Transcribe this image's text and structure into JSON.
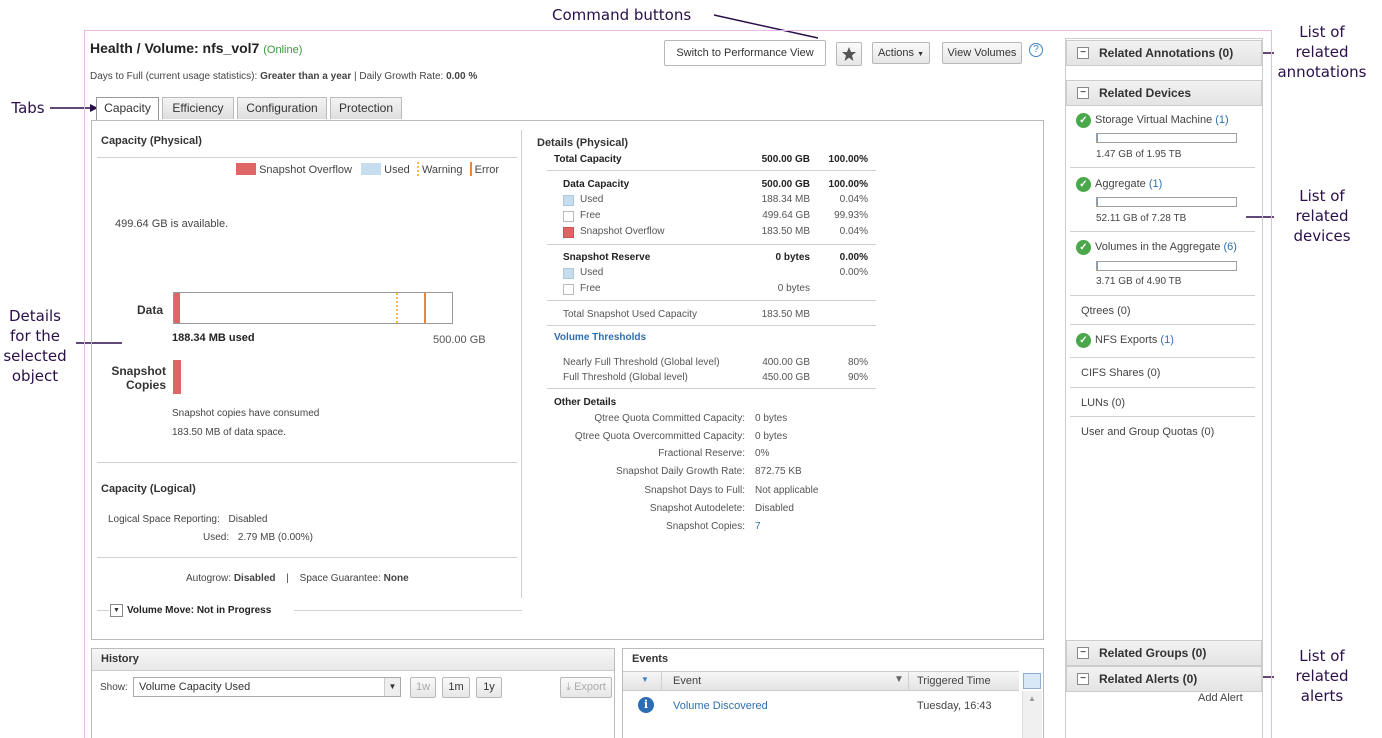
{
  "annotations": {
    "command_buttons": "Command buttons",
    "tabs": "Tabs",
    "details_selected": [
      "Details",
      "for the",
      "selected",
      "object"
    ],
    "related_annotations": [
      "List of",
      "related",
      "annotations"
    ],
    "related_devices": [
      "List of",
      "related",
      "devices"
    ],
    "related_alerts": [
      "List of",
      "related",
      "alerts"
    ]
  },
  "header": {
    "title": "Health / Volume: nfs_vol7",
    "status": "(Online)",
    "days_to_full_label": "Days to Full (current usage statistics):",
    "days_to_full_value": "Greater than a year",
    "growth_label": "| Daily Growth Rate:",
    "growth_value": "0.00 %"
  },
  "toolbar": {
    "switch_view": "Switch to Performance View",
    "actions": "Actions",
    "view_volumes": "View Volumes",
    "help": "?"
  },
  "tabs": [
    "Capacity",
    "Efficiency",
    "Configuration",
    "Protection"
  ],
  "capacity_physical": {
    "title": "Capacity (Physical)",
    "legend": [
      "Snapshot Overflow",
      "Used",
      "Warning",
      "Error"
    ],
    "available": "499.64 GB is available.",
    "data_label": "Data",
    "used_label": "188.34 MB used",
    "max_label": "500.00 GB",
    "snapshot_label_1": "Snapshot",
    "snapshot_label_2": "Copies",
    "snapshot_note_1": "Snapshot copies have consumed",
    "snapshot_note_2": "183.50 MB of data space.",
    "used_fraction": 0.0004,
    "warning_fraction": 0.8,
    "error_fraction": 0.9,
    "colors": {
      "overflow": "#e06666",
      "used": "#c6dcef",
      "warning": "#f0c040",
      "error": "#e8883a"
    }
  },
  "capacity_logical": {
    "title": "Capacity (Logical)",
    "reporting_label": "Logical Space Reporting:",
    "reporting_value": "Disabled",
    "used_label": "Used:",
    "used_value": "2.79 MB  (0.00%)",
    "autogrow_label": "Autogrow:",
    "autogrow_value": "Disabled",
    "guarantee_label": "Space Guarantee:",
    "guarantee_value": "None",
    "separator": "|"
  },
  "volume_move": "Volume Move: Not in Progress",
  "details_physical": {
    "title": "Details (Physical)",
    "total_label": "Total Capacity",
    "total_value": "500.00 GB",
    "total_pct": "100.00%",
    "data_capacity": {
      "label": "Data Capacity",
      "value": "500.00 GB",
      "pct": "100.00%"
    },
    "data_rows": [
      {
        "label": "Used",
        "value": "188.34 MB",
        "pct": "0.04%"
      },
      {
        "label": "Free",
        "value": "499.64 GB",
        "pct": "99.93%"
      },
      {
        "label": "Snapshot Overflow",
        "value": "183.50 MB",
        "pct": "0.04%"
      }
    ],
    "snapshot_reserve": {
      "label": "Snapshot Reserve",
      "value": "0 bytes",
      "pct": "0.00%"
    },
    "reserve_rows": [
      {
        "label": "Used",
        "value": "",
        "pct": "0.00%"
      },
      {
        "label": "Free",
        "value": "0 bytes",
        "pct": ""
      }
    ],
    "total_snapshot_label": "Total Snapshot Used Capacity",
    "total_snapshot_value": "183.50 MB",
    "thresholds_title": "Volume Thresholds",
    "nearly_full_label": "Nearly Full Threshold (Global level)",
    "nearly_full_value": "400.00 GB",
    "nearly_full_pct": "80%",
    "full_label": "Full Threshold (Global level)",
    "full_value": "450.00 GB",
    "full_pct": "90%",
    "other_title": "Other Details",
    "other_rows": [
      {
        "label": "Qtree Quota Committed Capacity:",
        "value": "0 bytes"
      },
      {
        "label": "Qtree Quota Overcommitted Capacity:",
        "value": "0 bytes"
      },
      {
        "label": "Fractional Reserve:",
        "value": "0%"
      },
      {
        "label": "Snapshot Daily Growth Rate:",
        "value": "872.75 KB"
      },
      {
        "label": "Snapshot Days to Full:",
        "value": "Not applicable"
      },
      {
        "label": "Snapshot Autodelete:",
        "value": "Disabled"
      },
      {
        "label": "Snapshot Copies:",
        "value": "7"
      }
    ]
  },
  "history": {
    "title": "History",
    "show_label": "Show:",
    "select_value": "Volume Capacity Used",
    "ranges": [
      "1w",
      "1m",
      "1y"
    ],
    "export": "Export"
  },
  "events": {
    "title": "Events",
    "col_event": "Event",
    "col_time": "Triggered Time",
    "rows": [
      {
        "event": "Volume Discovered",
        "time": "Tuesday, 16:43"
      }
    ]
  },
  "sidebar": {
    "annotations": "Related Annotations (0)",
    "devices": "Related Devices",
    "svm": {
      "label": "Storage Virtual Machine",
      "count": "(1)",
      "usage": "1.47 GB of 1.95 TB",
      "fraction": 0.0007
    },
    "aggregate": {
      "label": "Aggregate",
      "count": "(1)",
      "usage": "52.11 GB of 7.28 TB",
      "fraction": 0.007
    },
    "volumes_agg": {
      "label": "Volumes in the Aggregate",
      "count": "(6)",
      "usage": "3.71 GB of 4.90 TB",
      "fraction": 0.0008
    },
    "qtrees": "Qtrees (0)",
    "nfs_label": "NFS Exports",
    "nfs_count": "(1)",
    "cifs": "CIFS Shares (0)",
    "luns": "LUNs (0)",
    "quotas": "User and Group Quotas (0)",
    "groups": "Related Groups (0)",
    "alerts": "Related Alerts (0)",
    "add_alert": "Add Alert"
  }
}
